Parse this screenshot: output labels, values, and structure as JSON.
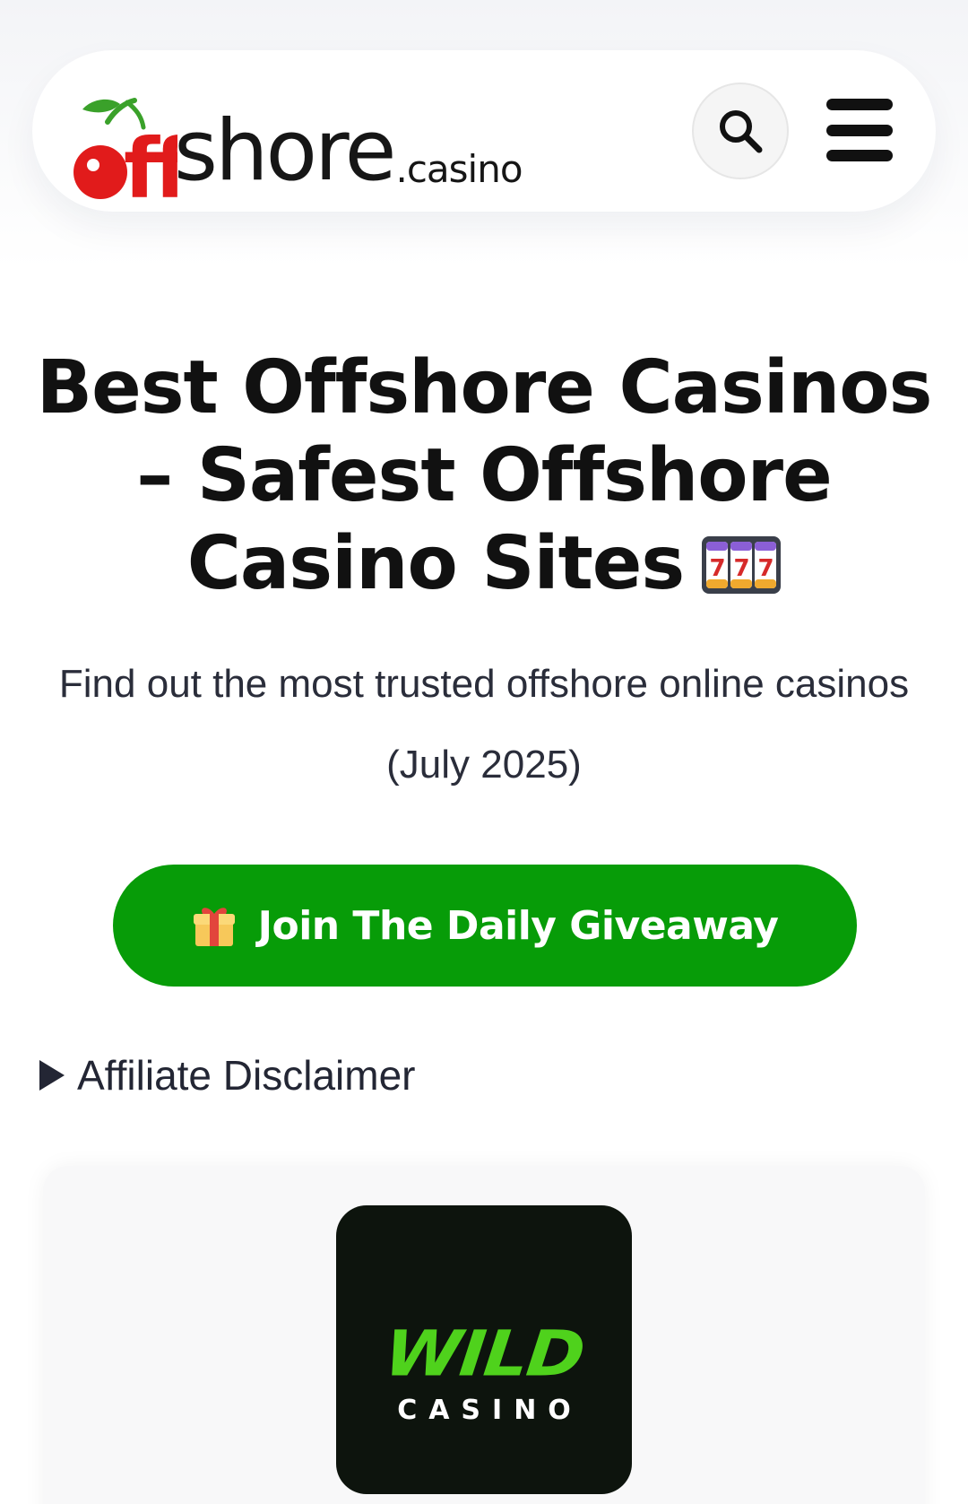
{
  "header": {
    "logo": {
      "mark": "offshore",
      "word": "shore",
      "tld": ".casino",
      "colors": {
        "cherry": "#e11b1b",
        "leaf": "#3aa12a",
        "ff": "#e11b1b",
        "text": "#161616"
      }
    },
    "search_icon": "search-icon",
    "menu_icon": "hamburger-menu-icon"
  },
  "hero": {
    "title": "Best Offshore Casinos – Safest Offshore Casino Sites",
    "title_emoji": "slot-machine-777-icon",
    "subtitle": "Find out the most trusted offshore online casinos (July 2025)"
  },
  "cta": {
    "label": "Join The Daily Giveaway",
    "icon": "gift-icon",
    "color": "#079c08"
  },
  "disclaimer": {
    "label": "Affiliate Disclaimer"
  },
  "casino_card": {
    "logo_word": "WILD",
    "logo_sub": "CASINO",
    "colors": {
      "bg": "#0d140d",
      "accent": "#4fd21c"
    }
  }
}
